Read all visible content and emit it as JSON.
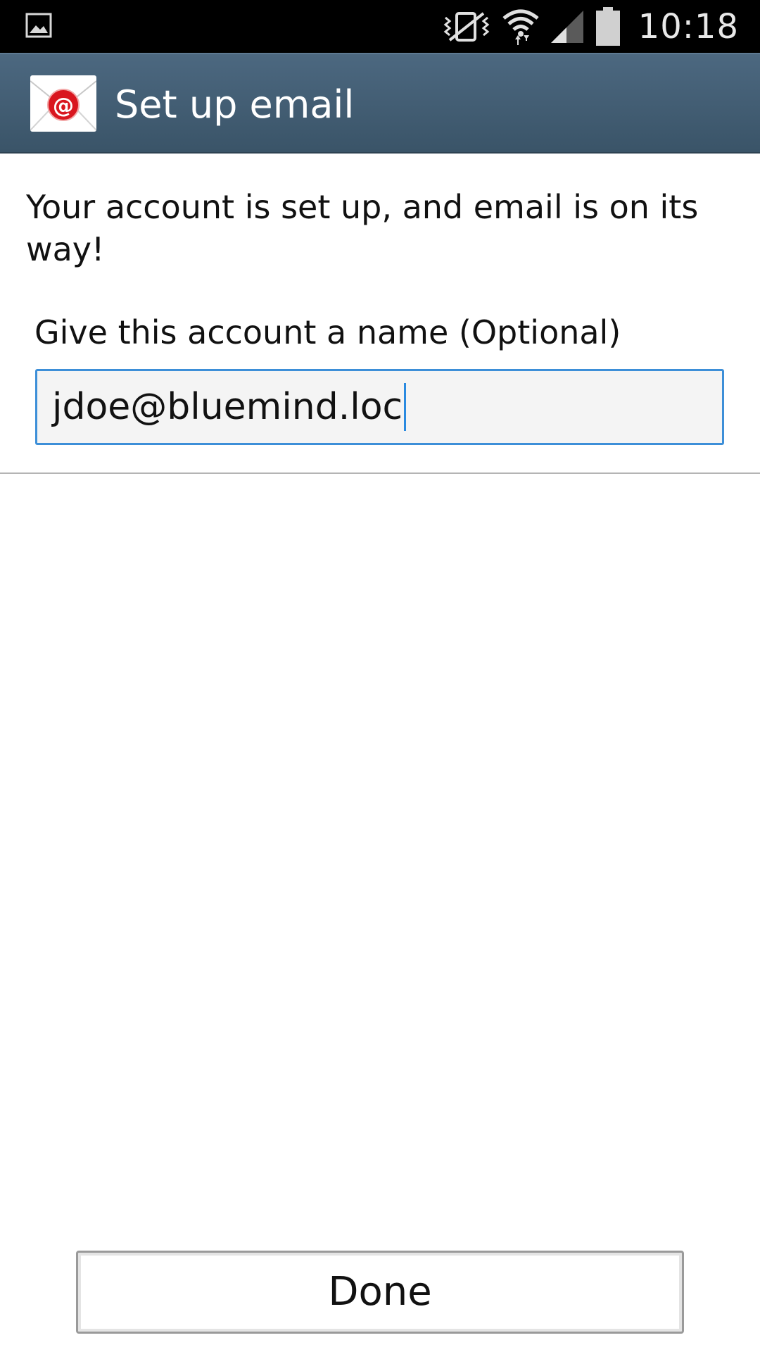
{
  "status_bar": {
    "time": "10:18",
    "icons": [
      "image-notification-icon",
      "vibrate-icon",
      "wifi-icon",
      "signal-icon",
      "battery-icon"
    ]
  },
  "action_bar": {
    "title": "Set up email",
    "app_icon": "email-app-icon"
  },
  "content": {
    "message": "Your account is set up, and email is on its way!",
    "account_name_label": "Give this account a name (Optional)",
    "account_name_value": "jdoe@bluemind.loc"
  },
  "footer": {
    "done_label": "Done"
  },
  "colors": {
    "action_bar": "#42596e",
    "input_focus_border": "#3d8fd8",
    "input_background": "#f4f4f4",
    "email_badge_red": "#d9161f"
  }
}
